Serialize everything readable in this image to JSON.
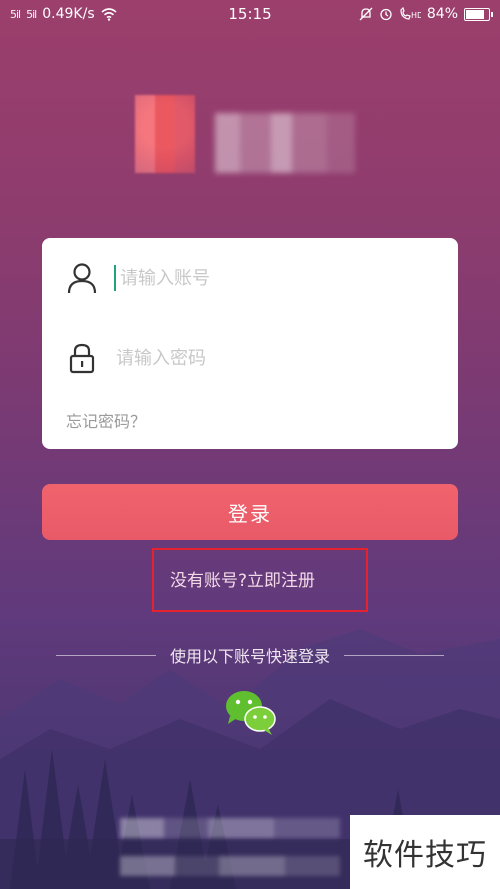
{
  "status_bar": {
    "signal_1": "5il",
    "signal_2": "5il",
    "net_speed": "0.49K/s",
    "time": "15:15",
    "battery": "84%",
    "battery_level": 0.84
  },
  "login_form": {
    "account_placeholder": "请输入账号",
    "password_placeholder": "请输入密码",
    "forgot_password": "忘记密码？"
  },
  "login_button": "登录",
  "register_link": "没有账号?立即注册",
  "quick_login_label": "使用以下账号快速登录",
  "watermark": "软件技巧",
  "colors": {
    "login_button": "#ec5f6b",
    "highlight_border": "#e5232e",
    "caret": "#1fa37f",
    "wechat_green": "#5fbf2f"
  },
  "icons": [
    "signal-icon",
    "wifi-icon",
    "mute-icon",
    "alarm-icon",
    "call-icon",
    "battery-icon",
    "user-icon",
    "lock-icon",
    "wechat-icon"
  ]
}
